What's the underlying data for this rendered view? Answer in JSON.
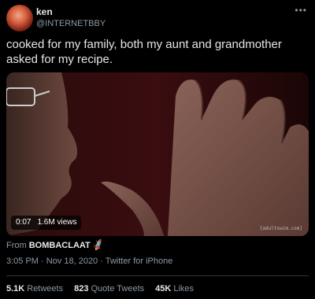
{
  "tweet": {
    "author_name": "ken",
    "author_handle": "@INTERNETBBY",
    "text": "cooked for my family, both my aunt and grandmother asked for my recipe.",
    "media": {
      "duration": "0:07",
      "views": "1.6M views",
      "watermark": "[adultswim.com]"
    },
    "from_label": "From",
    "from_account": "BOMBACLAAT",
    "timestamp": "3:05 PM · Nov 18, 2020 · Twitter for iPhone",
    "stats": {
      "retweets_count": "5.1K",
      "retweets_label": "Retweets",
      "quotes_count": "823",
      "quotes_label": "Quote Tweets",
      "likes_count": "45K",
      "likes_label": "Likes"
    }
  },
  "colors": {
    "background": "#000000",
    "secondary_text": "#8b98a5",
    "divider": "#2f3336"
  },
  "icons": {
    "more": "more-horizontal-icon",
    "rocket": "rocket-emoji-icon"
  }
}
